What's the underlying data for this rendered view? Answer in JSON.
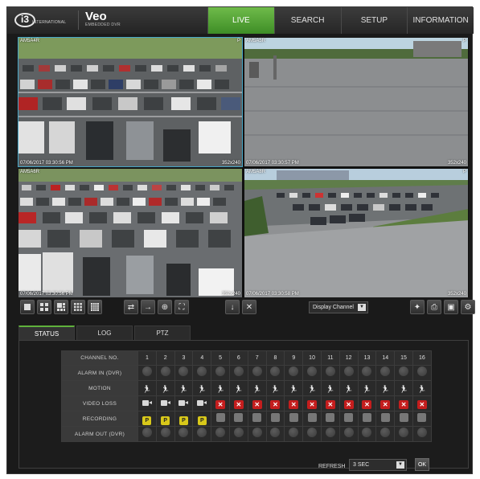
{
  "header": {
    "logo_text": "i3",
    "logo_sub": "INTERNATIONAL",
    "brand_name": "Veo",
    "brand_sub": "EMBEDDED DVR",
    "tabs": [
      {
        "label": "LIVE",
        "active": true
      },
      {
        "label": "SEARCH",
        "active": false
      },
      {
        "label": "SETUP",
        "active": false
      },
      {
        "label": "INFORMATION",
        "active": false
      }
    ]
  },
  "cameras": [
    {
      "name": "AM5A4R",
      "flag": "P",
      "timestamp": "07/06/2017 03:30:56 PM",
      "resolution": "352x240",
      "scene": "parking-lot",
      "selected": true
    },
    {
      "name": "AM5A5R",
      "flag": "P",
      "timestamp": "07/06/2017 03:30:57 PM",
      "resolution": "352x240",
      "scene": "rooftop",
      "selected": false
    },
    {
      "name": "AM5A6R",
      "flag": "P",
      "timestamp": "07/06/2017 03:30:56 PM",
      "resolution": "352x240",
      "scene": "parking-lot",
      "selected": false
    },
    {
      "name": "AM5A8R",
      "flag": "P",
      "timestamp": "07/06/2017 03:30:58 PM",
      "resolution": "352x240",
      "scene": "rooftop-lot",
      "selected": false
    }
  ],
  "toolbar": {
    "layout_buttons": [
      "layout-1-icon",
      "layout-4-icon",
      "layout-6-icon",
      "layout-9-icon",
      "layout-16-icon"
    ],
    "display_channel_label": "Display Channel"
  },
  "status_tabs": [
    {
      "label": "STATUS",
      "active": true
    },
    {
      "label": "LOG",
      "active": false
    },
    {
      "label": "PTZ",
      "active": false
    }
  ],
  "status_table": {
    "header_label": "CHANNEL NO.",
    "channels": [
      "1",
      "2",
      "3",
      "4",
      "5",
      "6",
      "7",
      "8",
      "9",
      "10",
      "11",
      "12",
      "13",
      "14",
      "15",
      "16"
    ],
    "rows": [
      {
        "label": "ALARM IN (DVR)",
        "kind": "dot"
      },
      {
        "label": "MOTION",
        "kind": "run"
      },
      {
        "label": "VIDEO LOSS",
        "kind": "videoloss",
        "lost": [
          false,
          false,
          false,
          false,
          true,
          true,
          true,
          true,
          true,
          true,
          true,
          true,
          true,
          true,
          true,
          true
        ]
      },
      {
        "label": "RECORDING",
        "kind": "rec",
        "recording": [
          true,
          true,
          true,
          true,
          false,
          false,
          false,
          false,
          false,
          false,
          false,
          false,
          false,
          false,
          false,
          false
        ],
        "glyph": "P"
      },
      {
        "label": "ALARM OUT (DVR)",
        "kind": "dot"
      }
    ]
  },
  "refresh": {
    "label": "REFRESH",
    "value": "3 SEC",
    "ok_label": "OK"
  }
}
